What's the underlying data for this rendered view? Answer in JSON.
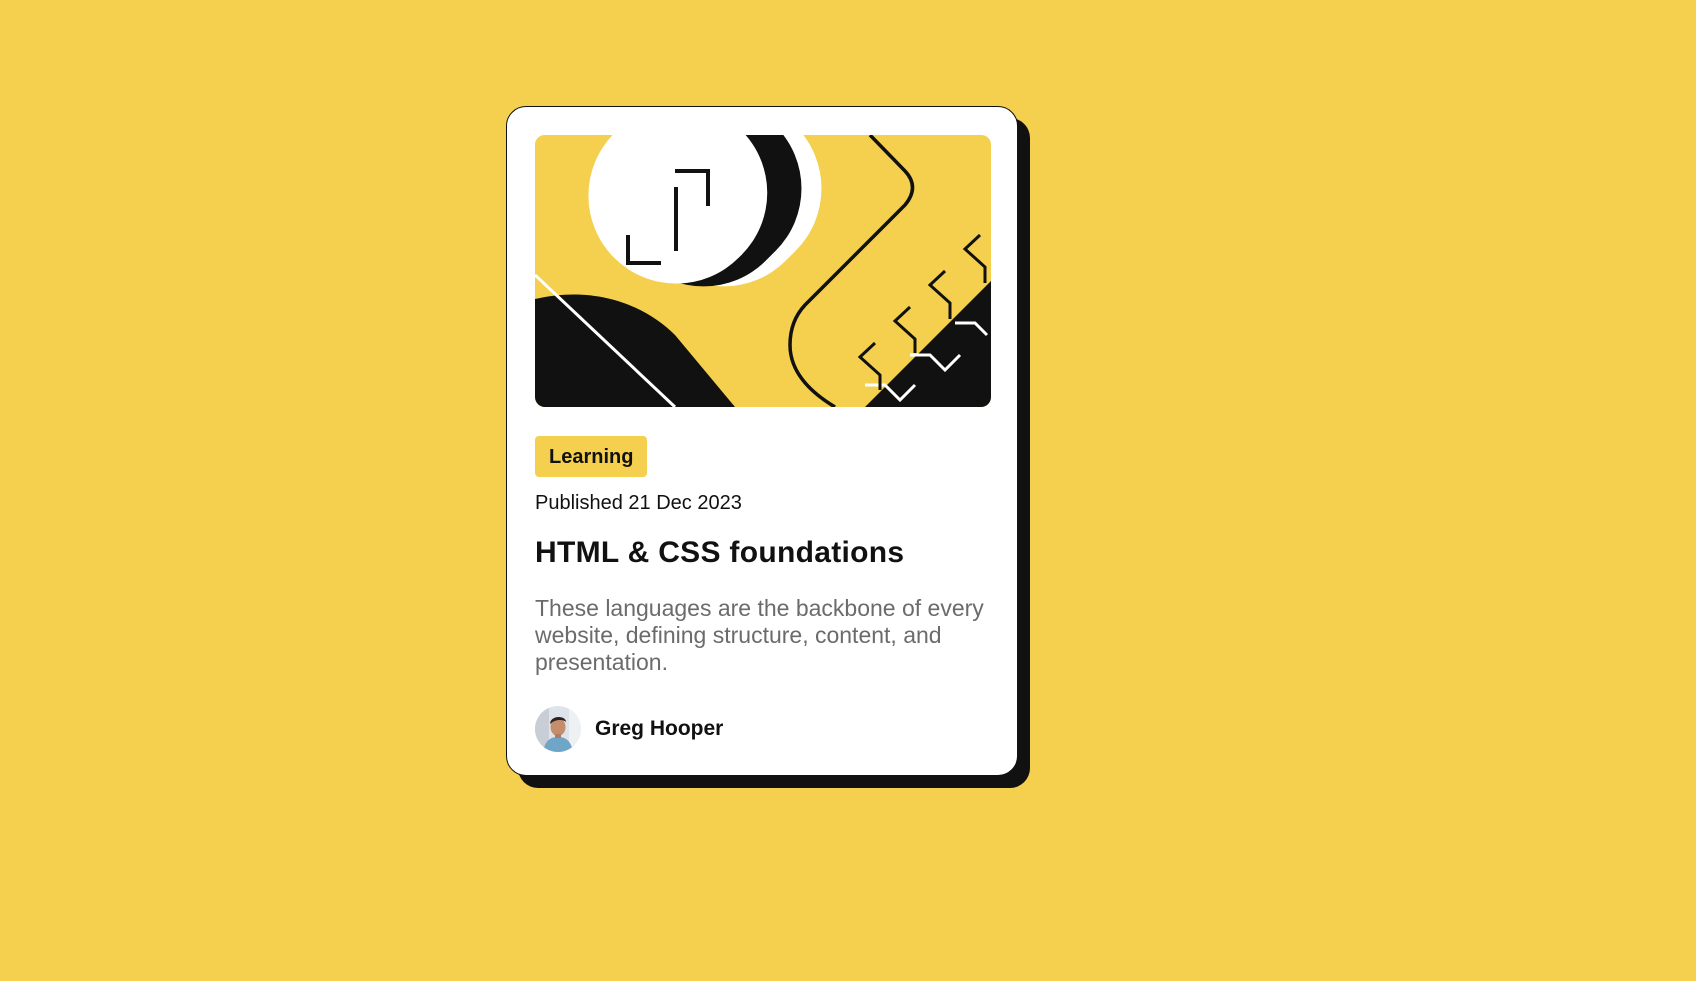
{
  "card": {
    "hero_image": "illustration-article",
    "category_tag": "Learning",
    "published": "Published 21 Dec 2023",
    "title": "HTML & CSS foundations",
    "description": "These languages are the backbone of every website, defining structure, content, and presentation.",
    "author": {
      "name": "Greg Hooper",
      "avatar": "image-avatar"
    }
  },
  "colors": {
    "background": "#f4d04e",
    "card": "#ffffff",
    "text": "#111111",
    "muted_text": "#6b6b6b",
    "shadow": "#111111"
  }
}
